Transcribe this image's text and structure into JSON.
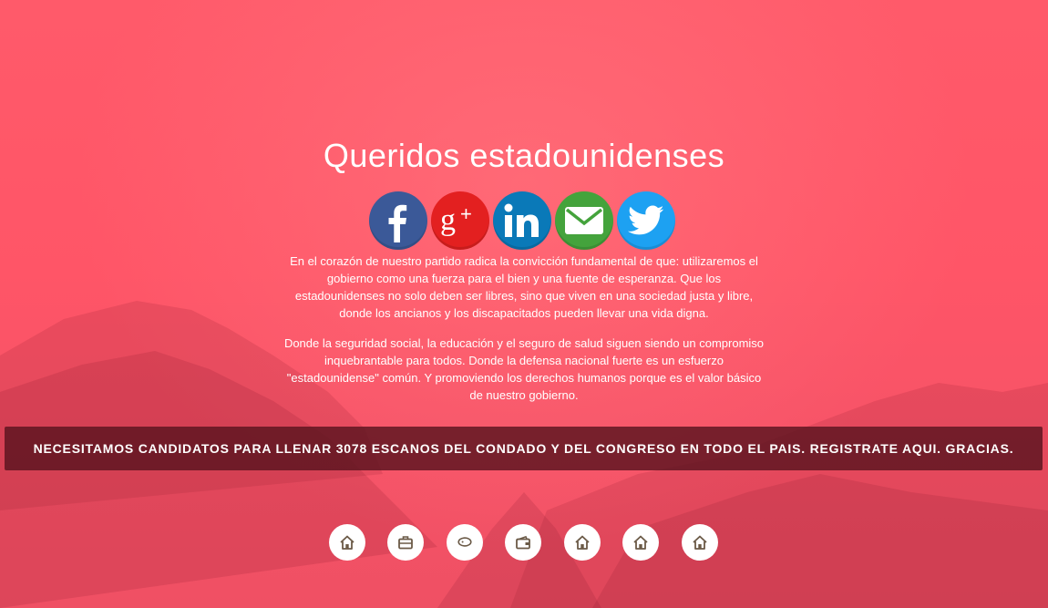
{
  "page": {
    "title": "Queridos estadounidenses",
    "paragraph_1": "En el corazón de nuestro partido radica la convicción fundamental de que: utilizaremos el gobierno como una fuerza para el bien y una fuente de esperanza. Que los estadounidenses no solo deben ser libres, sino que viven en una sociedad justa y libre, donde los ancianos y los discapacitados pueden llevar una vida digna.",
    "paragraph_2": "Donde la seguridad social, la educación y el seguro de salud siguen siendo un compromiso inquebrantable para todos. Donde la defensa nacional fuerte es un esfuerzo \"estadounidense\" común. Y promoviendo los derechos humanos porque es el valor básico de nuestro gobierno.",
    "banner_text": "NECESITAMOS CANDIDATOS PARA LLENAR 3078 ESCANOS DEL CONDADO Y DEL CONGRESO EN TODO EL PAIS. REGISTRATE AQUI. GRACIAS."
  },
  "social": [
    {
      "name": "facebook-icon",
      "color": "#3b5998"
    },
    {
      "name": "google-plus-icon",
      "color": "#e32020"
    },
    {
      "name": "linkedin-icon",
      "color": "#0a79b8"
    },
    {
      "name": "email-icon",
      "color": "#44a33c"
    },
    {
      "name": "twitter-icon",
      "color": "#1da1f2"
    }
  ],
  "bottom_icons": [
    "home-icon",
    "briefcase-icon",
    "chat-icon",
    "wallet-icon",
    "home-icon",
    "home-icon",
    "home-icon"
  ],
  "colors": {
    "background": "#ff5a6b",
    "banner": "#5a141e",
    "icon_glyph": "#6b5a47"
  }
}
